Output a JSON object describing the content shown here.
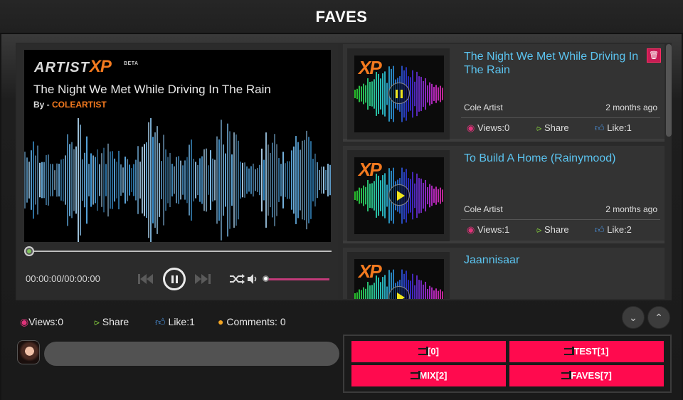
{
  "header": {
    "title": "FAVES"
  },
  "player": {
    "logo_main": "ARTIST",
    "logo_xp": "XP",
    "logo_badge": "BETA",
    "track_title": "The Night We Met While Driving In The Rain",
    "by_prefix": "By - ",
    "artist": "COLEARTIST",
    "time": "00:00:00/00:00:00",
    "progress": 0,
    "volume": 0
  },
  "tracks": [
    {
      "title": "The Night We Met While Driving In The Rain",
      "artist": "Cole Artist",
      "time_ago": "2 months ago",
      "views": "Views:0",
      "share": "Share",
      "likes": "Like:1",
      "playing": true
    },
    {
      "title": "To Build A Home (Rainymood)",
      "artist": "Cole Artist",
      "time_ago": "2 months ago",
      "views": "Views:1",
      "share": "Share",
      "likes": "Like:2",
      "playing": false
    },
    {
      "title": "Jaannisaar",
      "playing": false
    }
  ],
  "stats": {
    "views": "Views:0",
    "share": "Share",
    "likes": "Like:1",
    "comments": "Comments: 0"
  },
  "comment": {
    "placeholder": ""
  },
  "playlists": [
    {
      "label": "[0]"
    },
    {
      "label": "TEST[1]"
    },
    {
      "label": "MIX[2]"
    },
    {
      "label": "FAVES[7]"
    }
  ],
  "colors": {
    "accent": "#f47a1f",
    "link": "#5bc4f0",
    "playlist": "#ff0a4e",
    "views": "#e0337a",
    "share": "#7ec23c",
    "like": "#4a8fd8",
    "comment": "#f5a623"
  }
}
